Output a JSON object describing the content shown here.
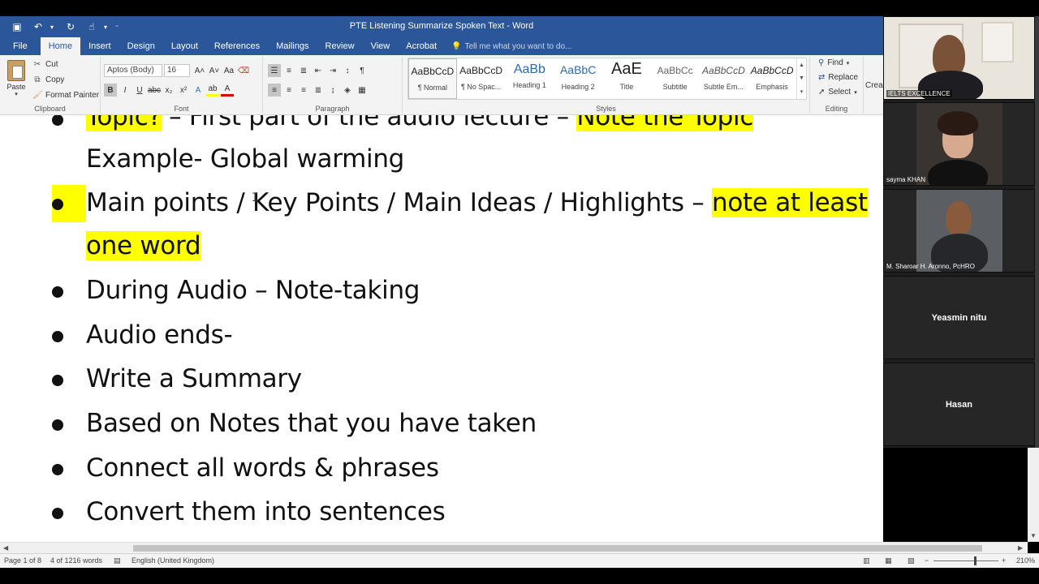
{
  "window": {
    "title": "PTE Listening Summarize Spoken Text - Word"
  },
  "tabs": [
    {
      "label": "File"
    },
    {
      "label": "Home"
    },
    {
      "label": "Insert"
    },
    {
      "label": "Design"
    },
    {
      "label": "Layout"
    },
    {
      "label": "References"
    },
    {
      "label": "Mailings"
    },
    {
      "label": "Review"
    },
    {
      "label": "View"
    },
    {
      "label": "Acrobat"
    }
  ],
  "tellme": "Tell me what you want to do...",
  "clipboard": {
    "paste": "Paste",
    "cut": "Cut",
    "copy": "Copy",
    "format_painter": "Format Painter",
    "label": "Clipboard"
  },
  "font": {
    "name": "Aptos (Body)",
    "size": "16",
    "label": "Font"
  },
  "paragraph": {
    "label": "Paragraph"
  },
  "styles": {
    "label": "Styles",
    "items": [
      {
        "preview": "AaBbCcD",
        "name": "¶ Normal"
      },
      {
        "preview": "AaBbCcD",
        "name": "¶ No Spac..."
      },
      {
        "preview": "AaBb",
        "name": "Heading 1"
      },
      {
        "preview": "AaBbC",
        "name": "Heading 2"
      },
      {
        "preview": "AaE",
        "name": "Title"
      },
      {
        "preview": "AaBbCc",
        "name": "Subtitle"
      },
      {
        "preview": "AaBbCcD",
        "name": "Subtle Em..."
      },
      {
        "preview": "AaBbCcD",
        "name": "Emphasis"
      }
    ]
  },
  "editing": {
    "find": "Find",
    "replace": "Replace",
    "select": "Select",
    "label": "Editing",
    "create": "Crea"
  },
  "document": {
    "line1_a": "Topic?",
    "line1_b": " – First part of the audio lecture – ",
    "line1_c": "Note the Topic",
    "line2": "Example- Global warming",
    "line3_a": "Main points / Key Points / Main Ideas / Highlights – ",
    "line3_b": "note at least",
    "line4": "one word",
    "bullets": [
      "During Audio – Note-taking",
      "Audio ends-",
      "Write a Summary",
      "Based on Notes that you have taken",
      "Connect all words & phrases",
      "Convert them into sentences"
    ]
  },
  "status": {
    "page": "Page 1 of 8",
    "words": "4 of 1216 words",
    "language": "English (United Kingdom)",
    "zoom": "210%"
  },
  "participants": [
    {
      "name": "IELTS EXCELLENCE"
    },
    {
      "name": "sayma KHAN"
    },
    {
      "name": "M. Sharoar H. Aronno, PcHRO"
    },
    {
      "name": "Yeasmin nitu"
    },
    {
      "name": "Hasan"
    }
  ]
}
